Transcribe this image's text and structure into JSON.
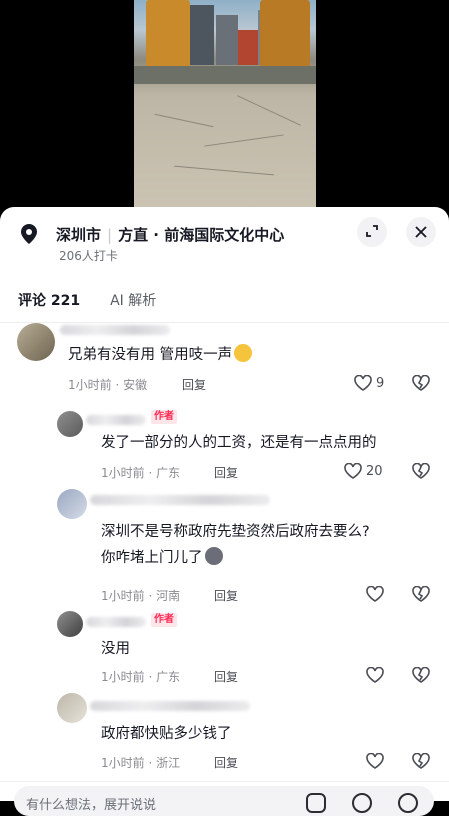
{
  "location": {
    "city": "深圳市",
    "place": "方直 · 前海国际文化中心",
    "checkins": "206人打卡"
  },
  "tabs": [
    {
      "label": "评论 221"
    },
    {
      "label": "AI 解析"
    }
  ],
  "comments": [
    {
      "text": "兄弟有没有用  管用吱一声",
      "time_loc": "1小时前 · 安徽",
      "reply": "回复",
      "likes": "9",
      "is_author": false
    },
    {
      "text": "发了一部分的人的工资，还是有一点点用的",
      "time_loc": "1小时前 · 广东",
      "reply": "回复",
      "likes": "20",
      "is_author": true,
      "badge": "作者"
    },
    {
      "text_line1": "深圳不是号称政府先垫资然后政府去要么?",
      "text_line2": "你咋堵上门儿了",
      "time_loc": "1小时前 · 河南",
      "reply": "回复",
      "is_author": false
    },
    {
      "text": "没用",
      "time_loc": "1小时前 · 广东",
      "reply": "回复",
      "is_author": true,
      "badge": "作者"
    },
    {
      "text": "政府都快贴多少钱了",
      "time_loc": "1小时前 · 浙江",
      "reply": "回复",
      "is_author": false
    }
  ],
  "input": {
    "placeholder": "有什么想法，展开说说"
  },
  "colors": {
    "accent": "#fe2c55",
    "text": "#161823",
    "meta": "#8a8b91"
  },
  "icons": [
    "location-pin-icon",
    "expand-icon",
    "close-icon",
    "heart-icon",
    "broken-heart-icon",
    "image-icon",
    "at-icon",
    "emoji-icon"
  ]
}
